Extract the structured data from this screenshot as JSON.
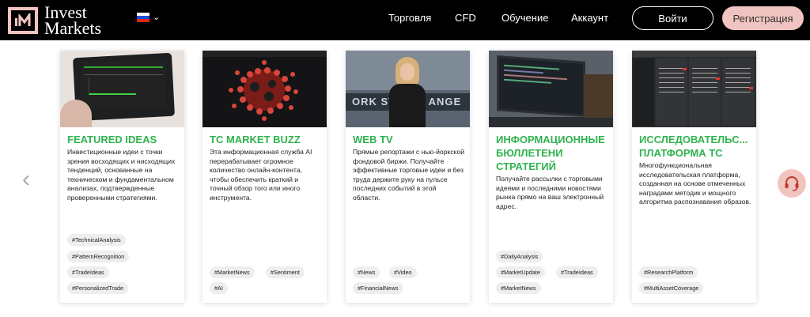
{
  "header": {
    "logo_text_line1": "Invest",
    "logo_text_line2": "Markets",
    "nav": [
      "Торговля",
      "CFD",
      "Обучение",
      "Аккаунт"
    ],
    "login_label": "Войти",
    "register_label": "Регистрация",
    "language_icon": "russia-flag-icon"
  },
  "cards": [
    {
      "title": "FEATURED IDEAS",
      "description": "Инвестиционные идеи с точки зрения восходящих и нисходящих тенденций, основанные на техническом и фундаментальном анализах, подтвержденные проверенными стратегиями.",
      "tags": [
        "#TechnicalAnalysis",
        "#PatternRecognition",
        "#TradeIdeas",
        "#PersonalizedTrade"
      ]
    },
    {
      "title": "TC MARKET BUZZ",
      "description": "Эта информационная служба AI перерабатывает огромное количество онлайн-контента, чтобы обеспечить краткий и точный обзор того или иного инструмента.",
      "tags": [
        "#MarketNews",
        "#Sentiment",
        "#AI"
      ]
    },
    {
      "title": "WEB TV",
      "description": "Прямые репортажи с нью-йоркской фондовой биржи. Получайте эффективные торговые идеи и без труда держите руку на пульсе последних событий в этой области.",
      "tags": [
        "#News",
        "#Video",
        "#FinancialNews"
      ]
    },
    {
      "title": "ИНФОРМАЦИОННЫЕ БЮЛЛЕТЕНИ СТРАТЕГИЙ",
      "description": "Получайте рассылки с торговыми идеями и последними новостями рынка прямо на ваш электронный адрес.",
      "tags": [
        "#DailyAnalysis",
        "#MarketUpdate",
        "#TradeIdeas",
        "#MarketNews"
      ]
    },
    {
      "title": "ИССЛЕДОВАТЕЛЬС... ПЛАТФОРМА TC",
      "description": "Многофункциональная исследовательская платформа, созданная на основе отмеченных наградами методик и мощного алгоритма распознавания образов.",
      "tags": [
        "#ResearchPlatform",
        "#MultiAssetCoverage"
      ]
    }
  ],
  "colors": {
    "accent_green": "#2fb34f",
    "brand_pink": "#f0c4c0",
    "header_bg": "#000000"
  }
}
